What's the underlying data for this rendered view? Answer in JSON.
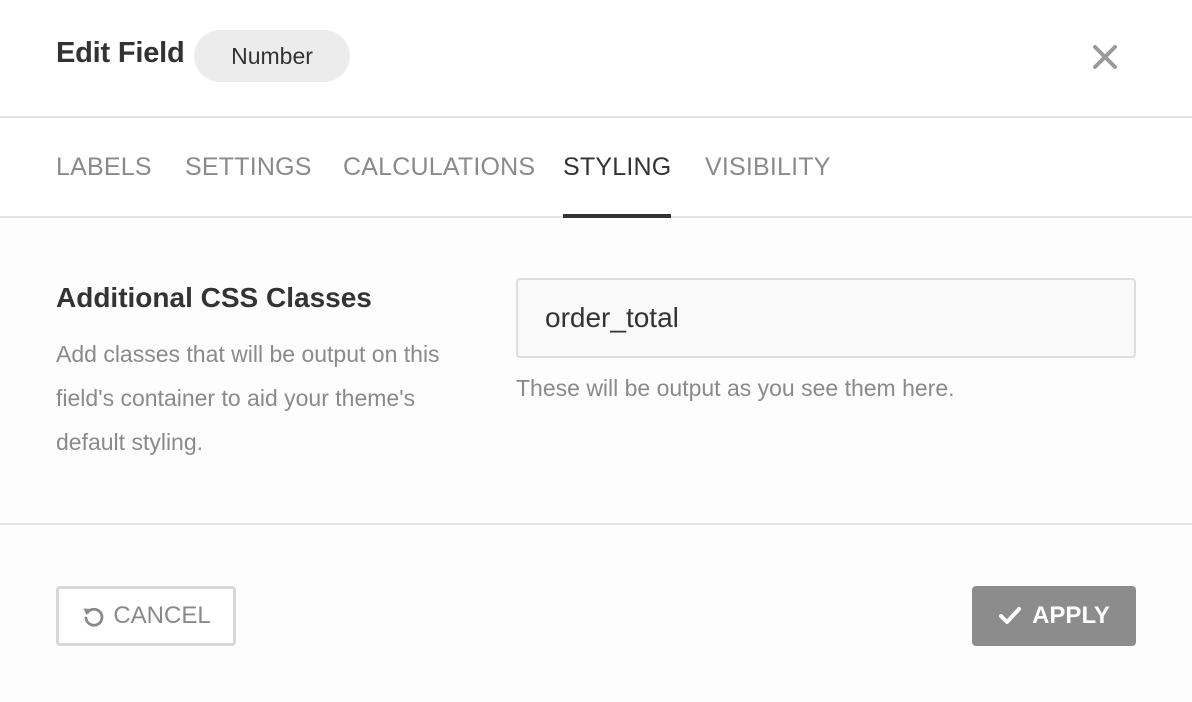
{
  "header": {
    "title": "Edit Field",
    "field_type": "Number",
    "close_icon": "close-icon"
  },
  "tabs": [
    {
      "label": "LABELS",
      "active": false
    },
    {
      "label": "SETTINGS",
      "active": false
    },
    {
      "label": "CALCULATIONS",
      "active": false
    },
    {
      "label": "STYLING",
      "active": true
    },
    {
      "label": "VISIBILITY",
      "active": false
    }
  ],
  "styling": {
    "label": "Additional CSS Classes",
    "description": "Add classes that will be output on this field's container to aid your theme's default styling.",
    "input_value": "order_total",
    "help_text": "These will be output as you see them here."
  },
  "footer": {
    "cancel_label": "CANCEL",
    "cancel_icon": "undo-icon",
    "apply_label": "APPLY",
    "apply_icon": "checkmark-icon"
  },
  "colors": {
    "text": "#333333",
    "muted": "#8a8a8a",
    "border": "#e2e2e2",
    "apply_bg": "#8c8c8c"
  }
}
